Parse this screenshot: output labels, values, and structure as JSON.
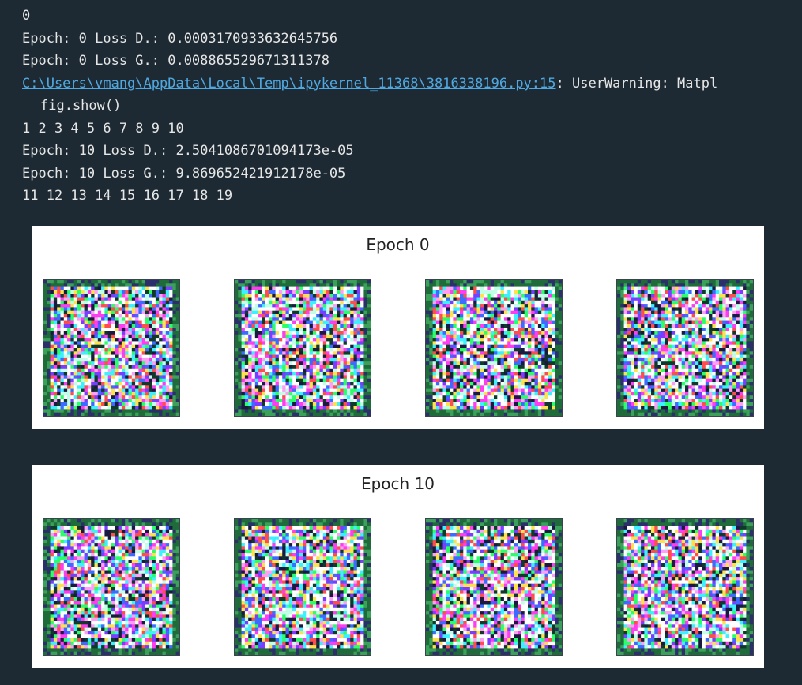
{
  "output": {
    "lines": [
      {
        "text": "0"
      },
      {
        "text": "Epoch: 0 Loss D.: 0.0003170933632645756"
      },
      {
        "text": "Epoch: 0 Loss G.: 0.008865529671311378"
      },
      {
        "link": "C:\\Users\\vmang\\AppData\\Local\\Temp\\ipykernel_11368\\3816338196.py:15",
        "text": ": UserWarning: Matpl"
      },
      {
        "text": "fig.show()",
        "indent": true
      },
      {
        "text": "1 2 3 4 5 6 7 8 9 10"
      },
      {
        "text": "Epoch: 10 Loss D.: 2.5041086701094173e-05"
      },
      {
        "text": "Epoch: 10 Loss G.: 9.869652421912178e-05"
      },
      {
        "text": "11 12 13 14 15 16 17 18 19"
      }
    ]
  },
  "figures": [
    {
      "title": "Epoch 0",
      "tiles": 4
    },
    {
      "title": "Epoch 10",
      "tiles": 4
    }
  ],
  "colors": {
    "background": "#1e2a33",
    "text": "#e6e6e6",
    "link": "#4fa8e0",
    "figure_bg": "#ffffff"
  }
}
